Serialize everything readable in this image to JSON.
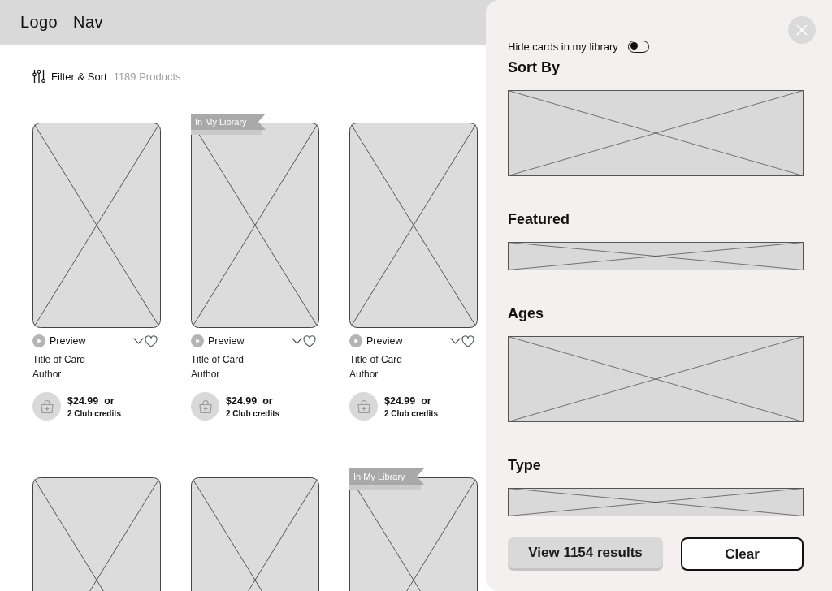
{
  "header": {
    "logo": "Logo",
    "nav": "Nav"
  },
  "toolbar": {
    "filter_label": "Filter & Sort",
    "count": "1189 Products"
  },
  "cards": [
    {
      "in_library": false,
      "preview": "Preview",
      "favorite": false,
      "title": "Title of Card",
      "author": "Author",
      "price": "$24.99",
      "price_or": "or",
      "credits": "2 Club credits"
    },
    {
      "in_library": true,
      "ribbon": "In My Library",
      "preview": "Preview",
      "favorite": false,
      "title": "Title of Card",
      "author": "Author",
      "price": "$24.99",
      "price_or": "or",
      "credits": "2 Club credits"
    },
    {
      "in_library": false,
      "preview": "Preview",
      "favorite": false,
      "title": "Title of Card",
      "author": "Author",
      "price": "$24.99",
      "price_or": "or",
      "credits": "2 Club credits"
    },
    {
      "in_library": false
    },
    {
      "in_library": false
    },
    {
      "in_library": true,
      "ribbon": "In My Library"
    }
  ],
  "filter_panel": {
    "hide_owned": {
      "label": "Hide cards in my library",
      "on": false
    },
    "sections": [
      {
        "heading": "Sort By",
        "kind": "tall"
      },
      {
        "heading": "Featured",
        "kind": "short"
      },
      {
        "heading": "Ages",
        "kind": "tall"
      },
      {
        "heading": "Type",
        "kind": "short"
      }
    ],
    "buttons": [
      {
        "label": "View 1154 results",
        "kind": "primary"
      },
      {
        "label": "Clear",
        "kind": "outline"
      }
    ]
  }
}
